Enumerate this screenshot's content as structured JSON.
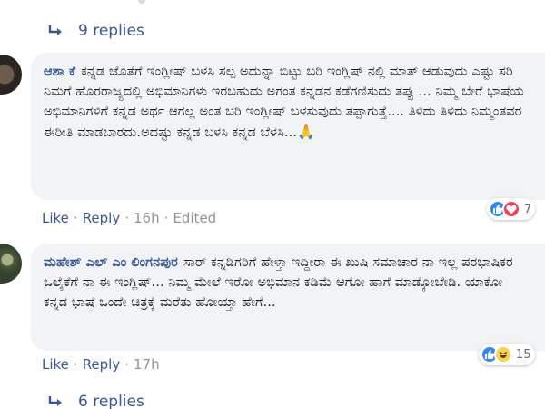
{
  "top_replies": {
    "label": "9 replies"
  },
  "comments": [
    {
      "author": "ಆಶಾ ಕೆ",
      "text": "ಕನ್ನಡ ಜೊತೆಗೆ ಇಂಗ್ಲೀಷ್ ಬಳಸಿ ಸಲ್ಪ ಅದುನ್ನಾ ಬಿಟ್ಟು ಬರಿ ಇಂಗ್ಲಿಷ್ ನಲ್ಲಿ ಮಾತ್ ಆಡುವುದು ಎಷ್ಟು ಸರಿ ನಿಮಗೆ ಹೊರರಾಜ್ಯದಲ್ಲಿ ಅಭಿಮಾನಿಗಳು ಇರಬಹುದು ಅಗಂತ ಕನ್ನಡನ ಕಡೆಗಣಿಸುದು ತಪ್ಪು ... ನಿಮ್ಮ ಬೇರೆ ಭಾಷೆಯ ಅಭಿಮಾನಿಗಳಿಗೆ ಕನ್ನಡ ಅರ್ಥ ಆಗಲ್ಲ ಅಂತ ಬರಿ ಇಂಗ್ಲೀಷ್ ಬಳಸುವುದು ತಪ್ಪಾಗುತ್ತೆ.... ತಿಳಿದು ತಿಳಿದು ನಿಮ್ಮಂತವರ ಈರೀತಿ ಮಾಡಬಾರದು.ಅದಷ್ಟು ಕನ್ನಡ ಬಳಸಿ ಕನ್ನಡ ಬೆಳಸಿ...",
      "emoji": "🙏",
      "like": "Like",
      "reply": "Reply",
      "time": "16h",
      "edited": "Edited",
      "reaction_count": "7",
      "reactions": [
        "like",
        "love"
      ]
    },
    {
      "author": "ಮಹೇಶ್ ಎಲ್ ಎಂ ಲಿಂಗನಪುರ",
      "text": "ಸಾರ್ ಕನ್ನಡಿಗರಿಗೆ ಹೇಳ್ತಾ ಇದ್ದೀರಾ ಈ ಖುಷಿ ಸಮಾಚಾರ ನಾ ಇಲ್ಲ ಪರಭಾಷಿಕರ ಒಲೈಕೆಗೆ ನಾ ಈ ಇಂಗ್ಲಿಷ್... ನಿಮ್ಮ ಮೇಲೆ ಇರೋ ಅಭಿಮಾನ ಕಡಿಮೆ ಆಗೋ ಹಾಗೆ ಮಾಡ್ಕೋಬೇಡಿ. ಯಾಕೋ ಕನ್ನಡ ಭಾಷೆ ಒಂದೇ ಚಿತ್ರಕ್ಕೆ ಮರೆತು ಹೋಯ್ತಾ ಹೇಗೆ...",
      "like": "Like",
      "reply": "Reply",
      "time": "17h",
      "reaction_count": "15",
      "reactions": [
        "like",
        "haha"
      ]
    }
  ],
  "bottom_replies": {
    "label": "6 replies"
  },
  "colors": {
    "link": "#385898",
    "bubble": "#f2f3f5",
    "like": "#2d88ff",
    "love": "#f33e58",
    "haha": "#fcd34d"
  }
}
